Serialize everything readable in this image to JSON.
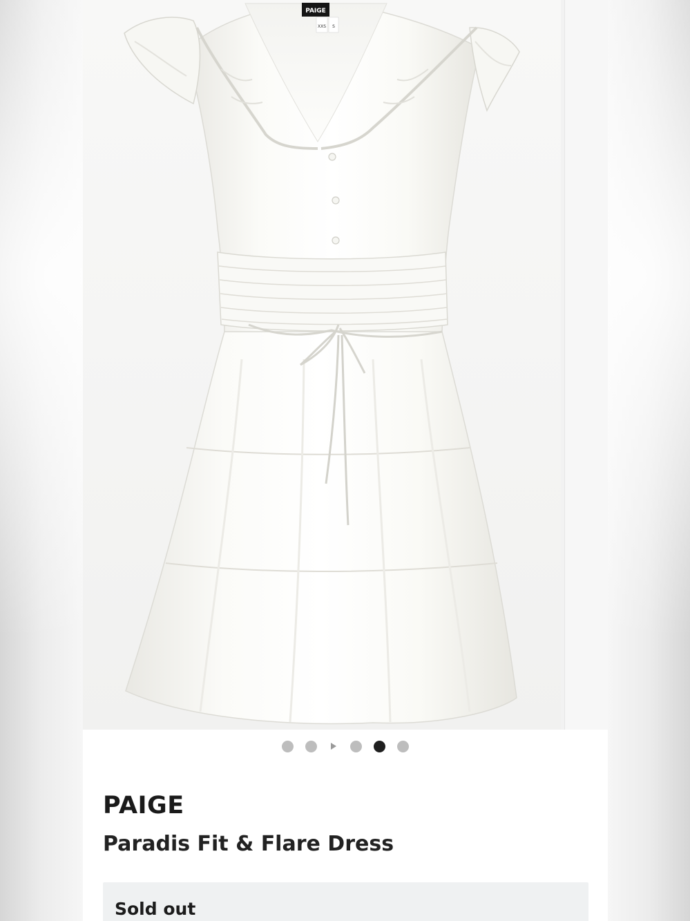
{
  "gallery": {
    "image_alt": "White ruffled v-neck fit and flare dress with smocked waist and tiered skirt",
    "garment_label": "PAIGE",
    "size_tag_1": "XXS",
    "size_tag_2": "S",
    "dots_count": 5,
    "active_dot_index": 3,
    "has_video_indicator": true
  },
  "product": {
    "brand": "PAIGE",
    "name": "Paradis Fit & Flare Dress",
    "status": "Sold out"
  },
  "colors": {
    "dot_inactive": "#bdbdbd",
    "dot_active": "#1f1f1f",
    "status_bg": "#eff1f2",
    "text": "#1a1a1a"
  }
}
